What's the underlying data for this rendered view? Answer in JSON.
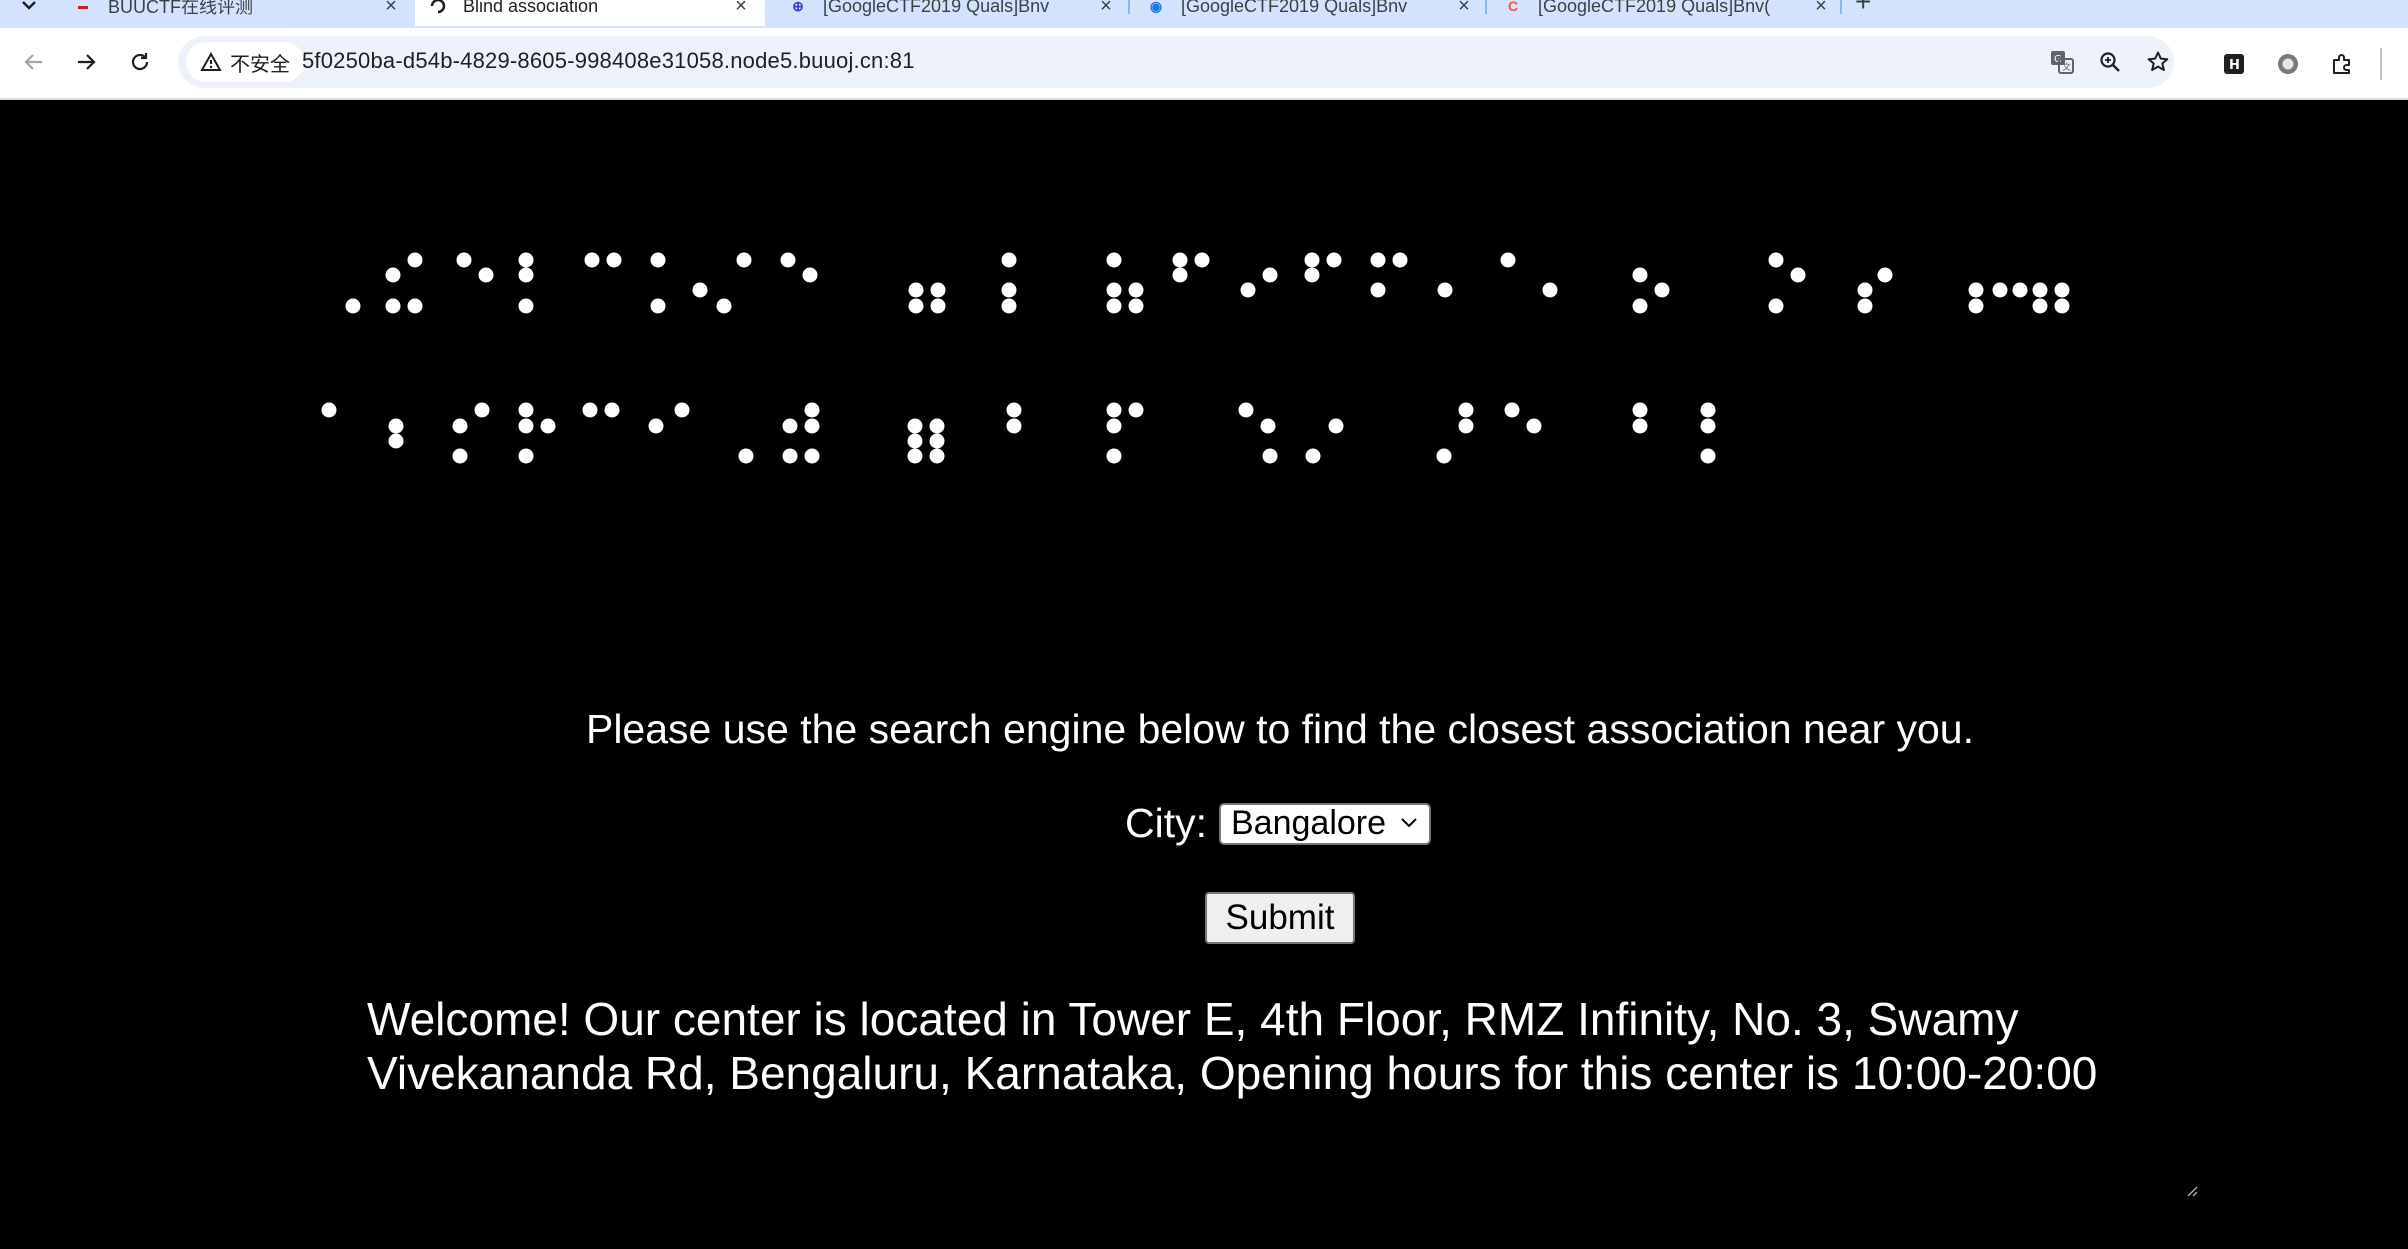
{
  "browser": {
    "tabs": [
      {
        "title": "BUUCTF在线评测",
        "favicon": "buuctf-logo-icon",
        "active": false
      },
      {
        "title": "Blind association",
        "favicon": "page-icon",
        "active": true
      },
      {
        "title": "[GoogleCTF2019 Quals]Bnv",
        "favicon": "csdn-icon",
        "active": false
      },
      {
        "title": "[GoogleCTF2019 Quals]Bnv",
        "favicon": "edge-icon",
        "active": false
      },
      {
        "title": "[GoogleCTF2019 Quals]Bnv(",
        "favicon": "csdn-red-icon",
        "active": false
      }
    ],
    "security_label": "不安全",
    "url": "5f0250ba-d54b-4829-8605-998408e31058.node5.buuoj.cn:81",
    "icons": [
      "back-icon",
      "forward-icon",
      "reload-icon",
      "warning-icon",
      "translate-icon",
      "zoom-icon",
      "bookmark-star-icon",
      "extension-h-icon",
      "extension-circle-icon",
      "extensions-puzzle-icon"
    ]
  },
  "page": {
    "braille_description": "braille-header",
    "intro_text": "Please use the search engine below to find the closest association near you.",
    "city_label": "City:",
    "city_selected": "Bangalore",
    "submit_label": "Submit",
    "result_text": "Welcome! Our center is located in Tower E, 4th Floor, RMZ Infinity, No. 3, Swamy Vivekananda Rd, Bengaluru, Karnataka, Opening hours for this center is 10:00-20:00"
  }
}
